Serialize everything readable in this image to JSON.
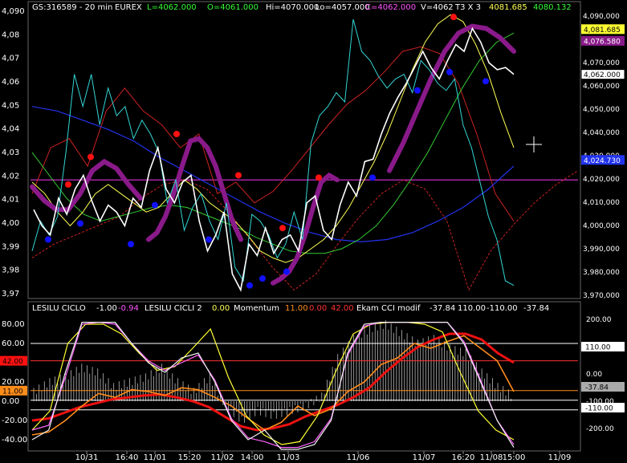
{
  "header_main": {
    "symbol": "GS:316589 - 20 min",
    "exchange": "EUREX",
    "last": "L=4062.000",
    "open": "O=4061.000",
    "high": "Hi=4070.000",
    "low": "Lo=4057.000",
    "close": "C=4062.000",
    "volume": "V=4062",
    "t3": "T3 X 3",
    "v1": "4081.685",
    "v2": "4080.132"
  },
  "header_sub": {
    "l1_name": "LESILU CICLO",
    "l1_a": "-1.00",
    "l1_b": "-0.94",
    "l2_name": "LESILU CICLI 2",
    "l2_a": "0.00",
    "mom_name": "Momentum",
    "mom_a": "11.00",
    "mom_b": "0.00",
    "mom_c": "42.00",
    "cci_name": "Ekam CCI modif",
    "cci_a": "-37.84",
    "cci_b": "110.00",
    "cci_c": "-110.00",
    "cci_d": "-37.84"
  },
  "colors": {
    "background": "#000000",
    "price": "#ffffff",
    "price_alt": "#33d6d6",
    "ma_fast": "#ffff55",
    "ma_mid": "#33cc33",
    "ma_slow": "#2233ee",
    "envelope": "#cc2222",
    "t3": "#8a1a8a",
    "hline": "#dd33dd",
    "high_dot": "#ff1111",
    "low_dot": "#1111ff",
    "osc_white": "#f0f0f0",
    "osc_magenta": "#ff66ff",
    "osc_yellow": "#ffff33",
    "momentum": "#ff8c1a",
    "cci_red": "#ee1111",
    "histogram": "#bbbbbb"
  },
  "chart_data": [
    {
      "type": "line",
      "panel": "price",
      "y_ticks": [
        "4,090",
        "4,08",
        "4,07",
        "4,06",
        "4,05",
        "4,04",
        "4,03",
        "4,02",
        "4,01",
        "4,00",
        "3,99",
        "3,98",
        "3,97"
      ],
      "y_right_ticks": [
        "4,090,000",
        "4,080,000",
        "4,070,000",
        "4,060,000",
        "4,050,000",
        "4,040,000",
        "4,030,000",
        "4,020,000",
        "4,010,000",
        "4,000,000",
        "3,990,000",
        "3,980,000",
        "3,970,000"
      ],
      "ylim": [
        3965,
        4093
      ],
      "marker_labels": [
        {
          "text": "4,081.685",
          "value": 4081.7
        },
        {
          "text": "4,076.580",
          "value": 4076.6
        },
        {
          "text": "4,062.000",
          "value": 4062.0
        },
        {
          "text": "4,024.730",
          "value": 4024.7
        }
      ],
      "horizontal_line": 4016,
      "series": [
        {
          "key": "price",
          "values": [
            4003,
            3996,
            3992,
            4008,
            4001,
            4012,
            4018,
            4007,
            3998,
            4005,
            4002,
            3996,
            4008,
            4004,
            4020,
            4030,
            4012,
            4006,
            4015,
            4018,
            3998,
            3985,
            3992,
            4002,
            3975,
            3968,
            3988,
            3983,
            3995,
            3984,
            3990,
            3992,
            3985,
            4006,
            4009,
            3994,
            3990,
            4005,
            4015,
            4009,
            4024,
            4025,
            4036,
            4045,
            4052,
            4058,
            4065,
            4072,
            4065,
            4060,
            4068,
            4075,
            4072,
            4082,
            4076,
            4067,
            4064,
            4065,
            4062
          ]
        },
        {
          "key": "price_alt",
          "values": [
            3985,
            3998,
            3992,
            4000,
            4028,
            4062,
            4048,
            4062,
            4040,
            4056,
            4044,
            4048,
            4034,
            4042,
            4036,
            4028,
            4006,
            4016,
            3994,
            4004,
            4010,
            3998,
            3990,
            4006,
            3978,
            3972,
            4001,
            3998,
            3992,
            3982,
            3988,
            4002,
            3990,
            4032,
            4044,
            4048,
            4054,
            4050,
            4086,
            4072,
            4068,
            4061,
            4056,
            4060,
            4062,
            4054,
            4068,
            4064,
            4058,
            4055,
            4060,
            4040,
            4030,
            4015,
            4000,
            3990,
            3972,
            3970
          ]
        },
        {
          "key": "ma_fast",
          "values": [
            4015,
            4010,
            4002,
            3996,
            4002,
            4010,
            4014,
            4010,
            4006,
            4002,
            4004,
            4010,
            4016,
            4012,
            4006,
            4002,
            3998,
            3992,
            3985,
            3982,
            3980,
            3982,
            3986,
            3990,
            3996,
            4004,
            4014,
            4024,
            4036,
            4050,
            4064,
            4076,
            4084,
            4088,
            4085,
            4075,
            4062,
            4045,
            4030
          ]
        },
        {
          "key": "ma_mid",
          "values": [
            4028,
            4018,
            4008,
            4001,
            3998,
            4000,
            4002,
            4004,
            4005,
            4004,
            4001,
            3998,
            3995,
            3991,
            3988,
            3985,
            3984,
            3984,
            3986,
            3990,
            3996,
            4005,
            4016,
            4028,
            4042,
            4056,
            4068,
            4076,
            4080
          ]
        },
        {
          "key": "ma_slow",
          "values": [
            4048,
            4046,
            4042,
            4038,
            4033,
            4026,
            4020,
            4014,
            4008,
            4002,
            3997,
            3993,
            3990,
            3989,
            3990,
            3993,
            3998,
            4004,
            4012,
            4022
          ]
        },
        {
          "key": "envelope_upper",
          "values": [
            4010,
            4030,
            4034,
            4022,
            4046,
            4056,
            4046,
            4040,
            4030,
            4036,
            4010,
            4015,
            4006,
            4011,
            4020,
            4030,
            4040,
            4049,
            4055,
            4063,
            4072,
            4074,
            4071,
            4058,
            4036,
            4010,
            3998
          ]
        },
        {
          "key": "envelope_lower",
          "values": [
            3982,
            3988,
            3992,
            3996,
            4000,
            4008,
            4014,
            4016,
            4012,
            4002,
            3990,
            3978,
            3968,
            3975,
            3988,
            4000,
            4010,
            4016,
            4012,
            3998,
            3968,
            3985,
            3996,
            4006,
            4014,
            4020
          ]
        },
        {
          "key": "t3_a",
          "values": [
            4013,
            4007,
            4003,
            4003,
            4010,
            4020,
            4024,
            4021,
            4014,
            4008
          ]
        },
        {
          "key": "t3_b",
          "values": [
            3990,
            3993,
            4000,
            4010,
            4022,
            4033,
            4034,
            4030,
            4022,
            4010,
            3998,
            3990
          ]
        },
        {
          "key": "t3_c",
          "values": [
            3971,
            3973,
            3976,
            3982,
            3992,
            4004,
            4015,
            4018,
            4016
          ]
        },
        {
          "key": "t3_d",
          "values": [
            4020,
            4032,
            4046,
            4060,
            4072,
            4080,
            4083,
            4082,
            4078,
            4072
          ]
        },
        {
          "key": "highs_dots",
          "values": [
            4014,
            4026,
            4036,
            4018,
            3995,
            4017,
            4087
          ]
        },
        {
          "key": "lows_dots",
          "values": [
            3990,
            3997,
            3988,
            4005,
            3990,
            3970,
            3973,
            3976,
            4017,
            4055,
            4063,
            4059
          ]
        }
      ]
    },
    {
      "type": "line",
      "panel": "oscillator",
      "y_ticks": [
        "80.00",
        "60.00",
        "40.00",
        "20.00",
        "0.00",
        "-20.00",
        "-40.00"
      ],
      "y_right_ticks": [
        "200.00",
        "100.00",
        "0.00",
        "-100.00",
        "-200.00"
      ],
      "ylim": [
        -50,
        90
      ],
      "left_labels": [
        "42.00",
        "11.00"
      ],
      "right_labels": [
        "110.00",
        "-37.84",
        "-110.00"
      ],
      "reference_lines": [
        60,
        42,
        11,
        1,
        -9
      ],
      "series": [
        {
          "key": "osc_white",
          "values": [
            -40,
            -30,
            30,
            82,
            82,
            82,
            60,
            40,
            30,
            45,
            50,
            20,
            -20,
            -40,
            -30,
            -50,
            -50,
            -45,
            -20,
            50,
            80,
            82,
            82,
            82,
            82,
            82,
            60,
            20,
            -20,
            -48
          ]
        },
        {
          "key": "osc_magenta",
          "values": [
            -30,
            -25,
            25,
            80,
            82,
            80,
            60,
            42,
            32,
            40,
            48,
            22,
            -18,
            -38,
            -42,
            -48,
            -48,
            -42,
            -18,
            48,
            78,
            82,
            82,
            82,
            82,
            82,
            62,
            22,
            -20,
            -45
          ]
        },
        {
          "key": "osc_yellow",
          "values": [
            -30,
            -10,
            60,
            80,
            80,
            70,
            50,
            32,
            36,
            55,
            75,
            25,
            -15,
            -35,
            -45,
            -42,
            -15,
            30,
            70,
            80,
            82,
            82,
            80,
            72,
            30,
            -10,
            -30,
            -40
          ]
        },
        {
          "key": "momentum",
          "values": [
            -35,
            -32,
            -20,
            -5,
            8,
            4,
            12,
            10,
            6,
            14,
            12,
            4,
            -5,
            -18,
            -30,
            -22,
            -5,
            -15,
            -8,
            10,
            20,
            38,
            45,
            60,
            55,
            62,
            68,
            55,
            42,
            10
          ]
        },
        {
          "key": "cci_red",
          "values": [
            -20,
            -18,
            -12,
            -6,
            -2,
            2,
            4,
            6,
            7,
            4,
            0,
            -6,
            -16,
            -26,
            -30,
            -28,
            -24,
            -16,
            -10,
            -4,
            4,
            14,
            30,
            44,
            56,
            64,
            70,
            70,
            64,
            50,
            40
          ]
        },
        {
          "key": "histogram",
          "values": [
            10,
            20,
            25,
            35,
            30,
            15,
            20,
            25,
            35,
            20,
            10,
            25,
            -5,
            -20,
            -10,
            -15,
            -10,
            -5,
            5,
            45,
            65,
            75,
            80,
            70,
            60,
            65,
            55,
            50,
            30,
            15,
            5
          ]
        }
      ]
    }
  ],
  "x_labels": [
    "10/31",
    "16:40",
    "11/01",
    "15:20",
    "11/02",
    "14:00",
    "11/03",
    "11/06",
    "11/07",
    "16:20",
    "11/08",
    "15:00",
    "11/09"
  ]
}
